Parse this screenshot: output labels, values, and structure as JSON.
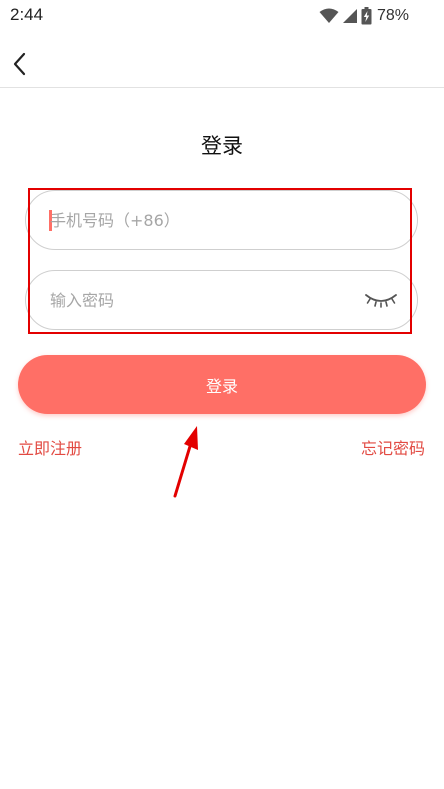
{
  "status_bar": {
    "time": "2:44",
    "battery": "78%",
    "icons": [
      "wifi-icon",
      "cellular-signal-icon",
      "battery-charging-icon"
    ]
  },
  "nav": {
    "back_icon": "chevron-left-icon"
  },
  "page": {
    "title": "登录"
  },
  "form": {
    "phone": {
      "placeholder": "手机号码（+86）",
      "value": ""
    },
    "password": {
      "placeholder": "输入密码",
      "value": "",
      "toggle_icon": "eye-closed-icon"
    },
    "submit_label": "登录"
  },
  "links": {
    "register": "立即注册",
    "forgot_password": "忘记密码"
  },
  "colors": {
    "accent": "#ff6f66",
    "link": "#e24a42",
    "annotation": "#e30000"
  }
}
